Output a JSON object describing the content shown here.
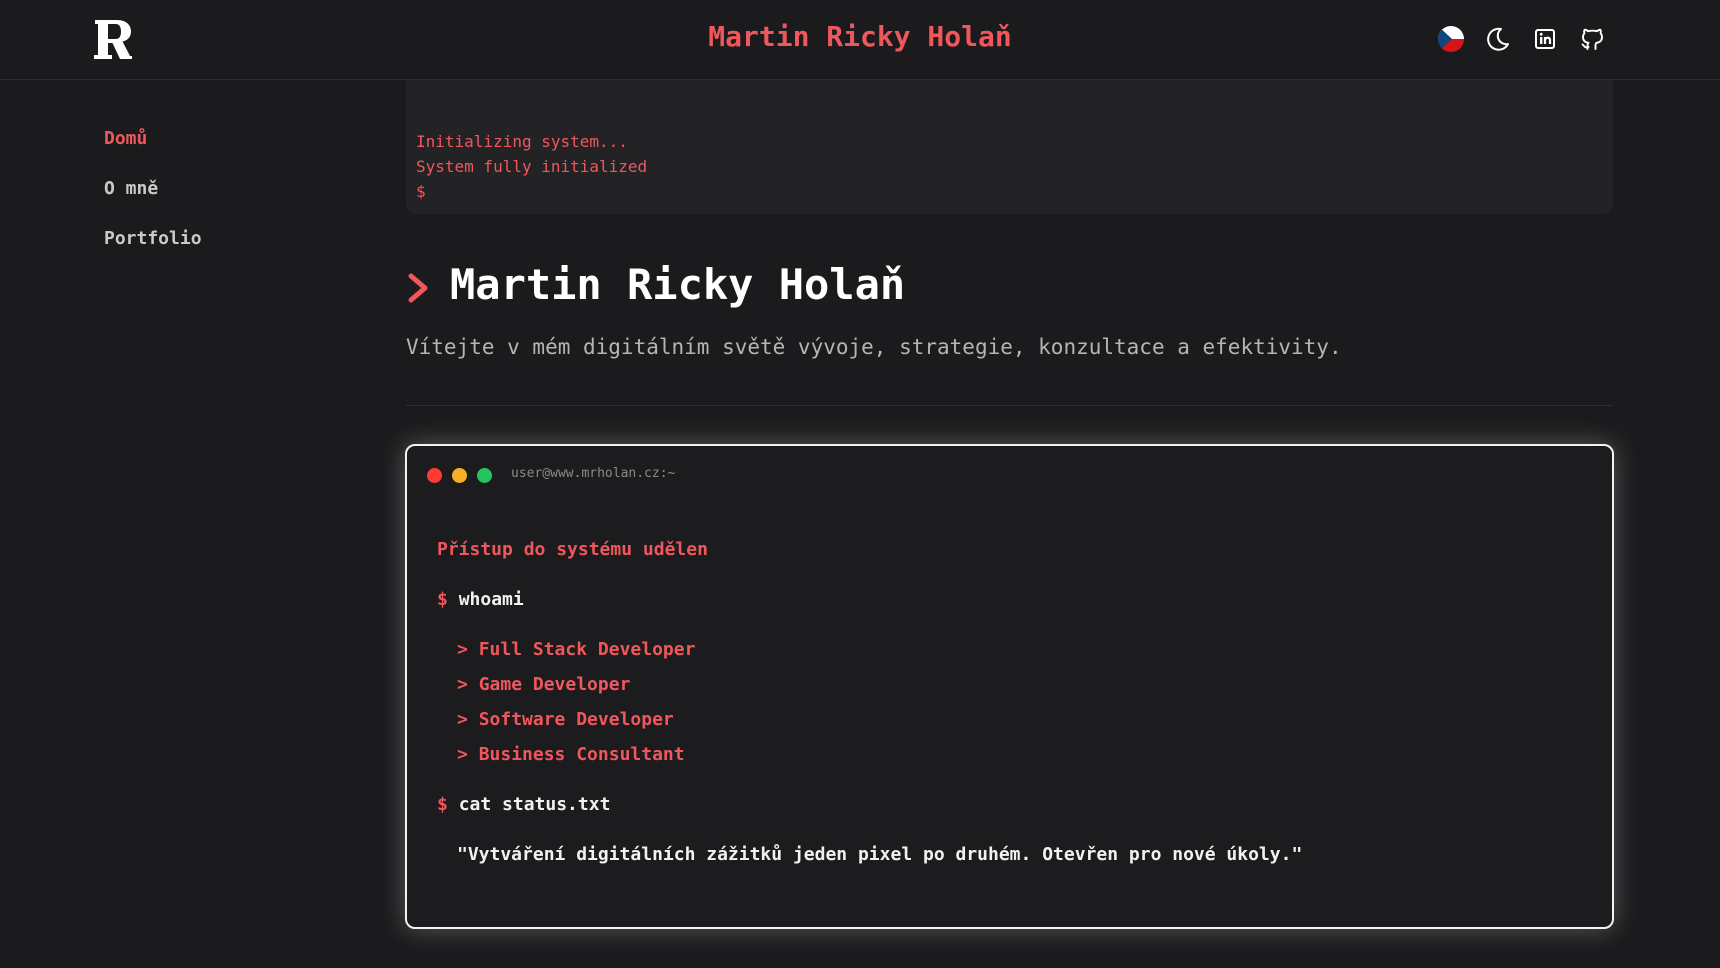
{
  "header": {
    "site_title": "Martin Ricky Holaň",
    "logo_letter": "R",
    "icons": [
      "czech-flag-icon",
      "moon-icon",
      "linkedin-icon",
      "github-icon"
    ]
  },
  "sidebar": {
    "items": [
      {
        "label": "Domů",
        "active": true
      },
      {
        "label": "O mně",
        "active": false
      },
      {
        "label": "Portfolio",
        "active": false
      }
    ]
  },
  "boot_console": {
    "lines": [
      "Initializing system...",
      "System fully initialized",
      "$"
    ]
  },
  "hero": {
    "title": "Martin Ricky Holaň",
    "subtitle": "Vítejte v mém digitálním světě vývoje, strategie, konzultace a efektivity."
  },
  "terminal": {
    "path": "user@www.mrholan.cz:~",
    "access": "Přístup do systému udělen",
    "prompt": "$",
    "cmd1": "whoami",
    "roles": [
      "Full Stack Developer",
      "Game Developer",
      "Software Developer",
      "Business Consultant"
    ],
    "role_marker": ">",
    "cmd2": "cat status.txt",
    "status": "\"Vytváření digitálních zážitků jeden pixel po druhém. Otevřen pro nové úkoly.\""
  },
  "colors": {
    "accent": "#f0575d",
    "background": "#1b1b1d",
    "dot_red": "#ff3b30",
    "dot_yellow": "#f5b025",
    "dot_green": "#22c55e"
  }
}
